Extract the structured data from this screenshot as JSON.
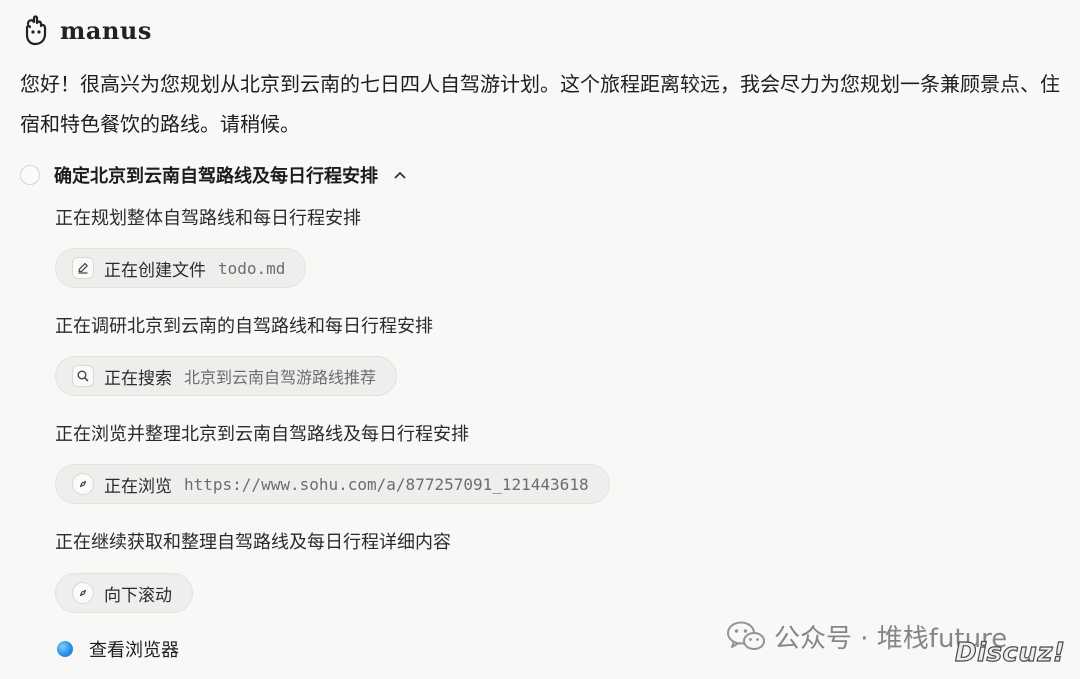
{
  "app": {
    "brand": "manus",
    "logo_icon": "manus-hand-logo-icon"
  },
  "message": {
    "intro": "您好！很高兴为您规划从北京到云南的七日四人自驾游计划。这个旅程距离较远，我会尽力为您规划一条兼顾景点、住宿和特色餐饮的路线。请稍候。"
  },
  "task": {
    "title": "确定北京到云南自驾路线及每日行程安排",
    "expanded_icon": "chevron-up-icon",
    "steps": [
      {
        "description": "正在规划整体自驾路线和每日行程安排",
        "action": "正在创建文件",
        "argument": "todo.md",
        "icon": "edit-icon"
      },
      {
        "description": "正在调研北京到云南的自驾路线和每日行程安排",
        "action": "正在搜索",
        "argument": "北京到云南自驾游路线推荐",
        "icon": "search-icon"
      },
      {
        "description": "正在浏览并整理北京到云南自驾路线及每日行程安排",
        "action": "正在浏览",
        "argument": "https://www.sohu.com/a/877257091_121443618",
        "icon": "compass-icon"
      },
      {
        "description": "正在继续获取和整理自驾路线及每日行程详细内容",
        "action": "向下滚动",
        "argument": "",
        "icon": "compass-icon"
      }
    ]
  },
  "live": {
    "label": "查看浏览器",
    "color": "#2a8fe8"
  },
  "watermark": {
    "text": "公众号 · 堆栈future",
    "discuz": "Discuz!"
  }
}
